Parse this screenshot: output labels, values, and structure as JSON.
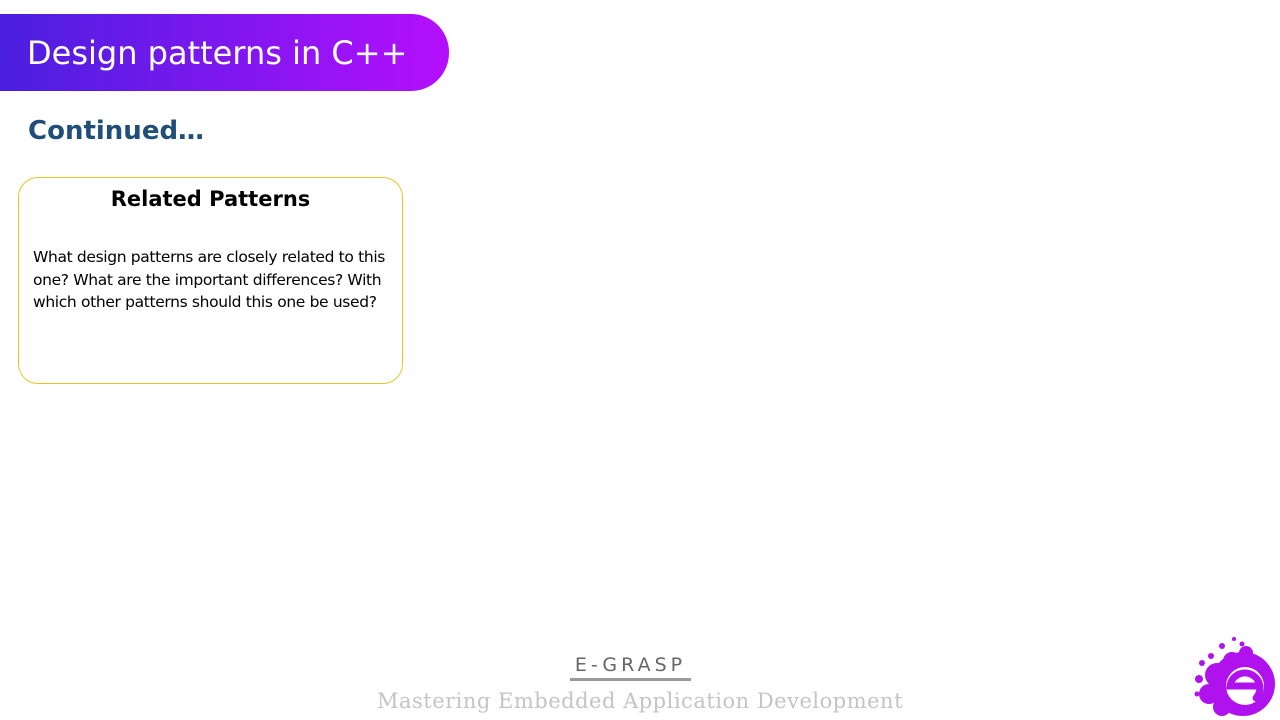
{
  "header": {
    "title": "Design patterns in C++"
  },
  "subtitle": "Continued…",
  "card": {
    "heading": "Related Patterns",
    "body": "What design patterns are closely related to this one? What are the important differences? With which other patterns should this one be used?"
  },
  "footer": {
    "brand": "E-GRASP",
    "tagline": "Mastering Embedded Application Development"
  },
  "logo": {
    "icon": "e-grasp-logo-icon"
  },
  "colors": {
    "banner_start": "#4a1fdf",
    "banner_end": "#b50ffd",
    "subtitle": "#1f4e79",
    "card_border": "#e7c42a",
    "logo_purple": "#b012ee"
  }
}
